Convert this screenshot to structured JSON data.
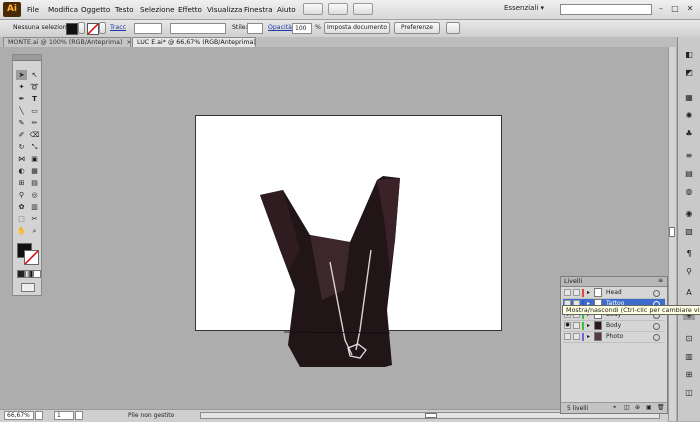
{
  "app": {
    "logo": "Ai"
  },
  "menu": [
    "File",
    "Modifica",
    "Oggetto",
    "Testo",
    "Selezione",
    "Effetto",
    "Visualizza",
    "Finestra",
    "Aiuto"
  ],
  "workspace": {
    "label": "Essenziali",
    "arrow": "▾"
  },
  "window_controls": [
    "–",
    "□",
    "✕"
  ],
  "control_bar": {
    "selection_label": "Nessuna selezione",
    "stroke_link": "Tracc",
    "style_label": "Stile:",
    "opacity_link": "Opacità:",
    "opacity_value": "100",
    "opacity_unit": "%",
    "doc_setup_button": "Imposta documento",
    "prefs_button": "Preferenze"
  },
  "tabs": [
    {
      "label": "MONTE.ai @ 100% (RGB/Anteprima)",
      "close": "×",
      "active": false
    },
    {
      "label": "LUC E.ai* @ 66,67% (RGB/Anteprima)",
      "close": "×",
      "active": true
    }
  ],
  "status_bar": {
    "zoom": "66,67%",
    "artboard_number": "1",
    "status_text": "Pile non gestito"
  },
  "layers_panel": {
    "title": "Livelli",
    "count": "5 livelli",
    "layers": [
      {
        "name": "Head",
        "color": "#e0443c",
        "visible": false,
        "selected": false
      },
      {
        "name": "Tattoo",
        "color": "#2a5bd7",
        "visible": false,
        "selected": true
      },
      {
        "name": "Body",
        "color": "#36c436",
        "visible": true,
        "selected": false
      },
      {
        "name": "Body",
        "color": "#36c436",
        "visible": true,
        "selected": false
      },
      {
        "name": "Photo",
        "color": "#6a6ad8",
        "visible": false,
        "selected": false
      }
    ]
  },
  "tooltip": "Mostra/nascondi (Ctrl-clic per cambiare vista)",
  "colors": {
    "accent": "#3d6ccc",
    "artwork": "#221518"
  }
}
